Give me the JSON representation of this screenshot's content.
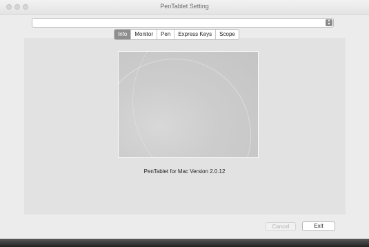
{
  "window": {
    "title": "PenTablet Setting"
  },
  "select": {
    "value": "",
    "arrow_icon": "up-down-arrows-icon"
  },
  "tabs": [
    {
      "label": "Info",
      "active": true
    },
    {
      "label": "Monitor",
      "active": false
    },
    {
      "label": "Pen",
      "active": false
    },
    {
      "label": "Express Keys",
      "active": false
    },
    {
      "label": "Scope",
      "active": false
    }
  ],
  "info": {
    "version_text": "PenTablet for Mac Version 2.0.12"
  },
  "buttons": {
    "cancel_label": "Cancel",
    "exit_label": "Exit"
  },
  "colors": {
    "active_tab": "#8e8e8e",
    "panel_bg": "#e2e2e2"
  }
}
